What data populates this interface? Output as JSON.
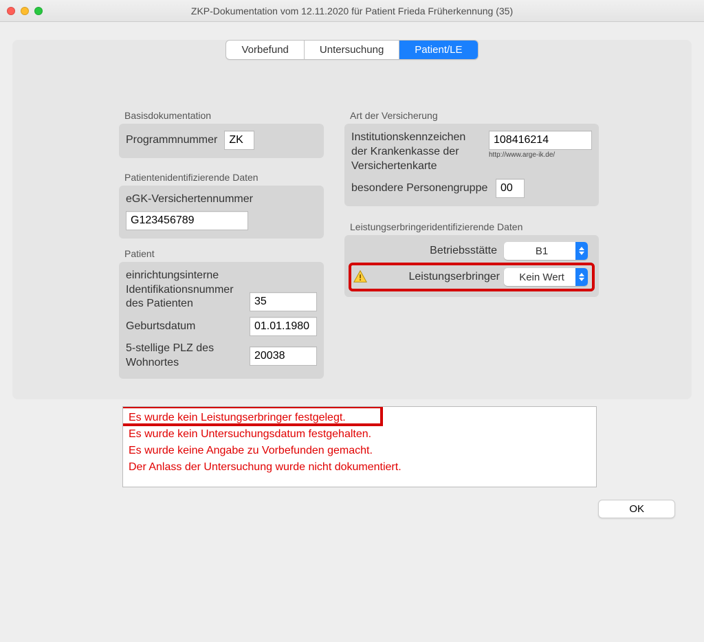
{
  "window": {
    "title": "ZKP-Dokumentation vom 12.11.2020 für Patient Frieda Früherkennung (35)"
  },
  "tabs": {
    "vorbefund": "Vorbefund",
    "untersuchung": "Untersuchung",
    "patient_le": "Patient/LE"
  },
  "basis": {
    "legend": "Basisdokumentation",
    "programmnummer_label": "Programmnummer",
    "programmnummer_value": "ZK"
  },
  "pid": {
    "legend": "Patientenidentifizierende Daten",
    "egk_label": "eGK-Versichertennummer",
    "egk_value": "G123456789"
  },
  "patient": {
    "legend": "Patient",
    "internal_id_label": "einrichtungsinterne Identifikationsnummer des Patienten",
    "internal_id_value": "35",
    "geburt_label": "Geburtsdatum",
    "geburt_value": "01.01.1980",
    "plz_label": "5-stellige PLZ des Wohnortes",
    "plz_value": "20038"
  },
  "insurance": {
    "legend": "Art der Versicherung",
    "ik_label": "Institutionskennzeichen der Krankenkasse der Versichertenkarte",
    "ik_value": "108416214",
    "ik_link": "http://www.arge-ik.de/",
    "group_label": "besondere Personengruppe",
    "group_value": "00"
  },
  "provider": {
    "legend": "Leistungserbringeridentifizierende Daten",
    "betrieb_label": "Betriebsstätte",
    "betrieb_value": "B1",
    "leistung_label": "Leistungserbringer",
    "leistung_value": "Kein Wert"
  },
  "errors": [
    "Es wurde kein Leistungserbringer festgelegt.",
    "Es wurde kein Untersuchungsdatum festgehalten.",
    "Es wurde keine Angabe zu Vorbefunden gemacht.",
    "Der Anlass der Untersuchung wurde nicht dokumentiert."
  ],
  "ok": "OK"
}
